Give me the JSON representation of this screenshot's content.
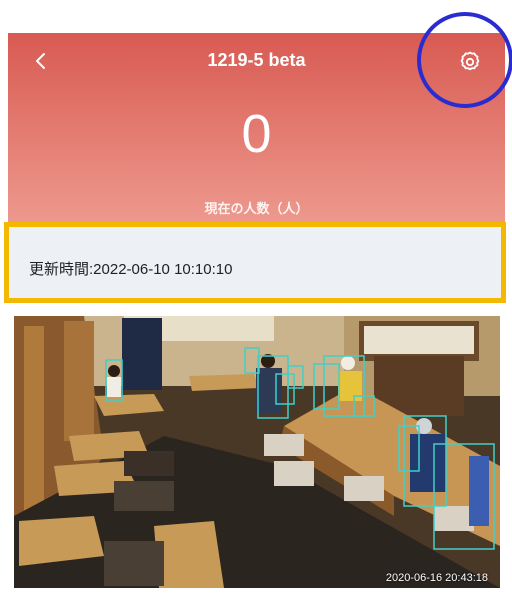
{
  "header": {
    "title": "1219-5 beta",
    "back_icon": "chevron-left-icon",
    "settings_icon": "gear-icon",
    "count": "0",
    "count_label": "現在の人数（人）",
    "gradient_top": "#d85a52",
    "gradient_bottom": "#ee9a8f"
  },
  "update": {
    "text": "更新時間:2022-06-10 10:10:10",
    "highlight_color": "#f5b800"
  },
  "annotation": {
    "ring_color": "#2b2ccf"
  },
  "camera": {
    "timestamp": "2020-06-16 20:43:18",
    "detection_box_color": "#3fd0c9",
    "detections": 11
  }
}
